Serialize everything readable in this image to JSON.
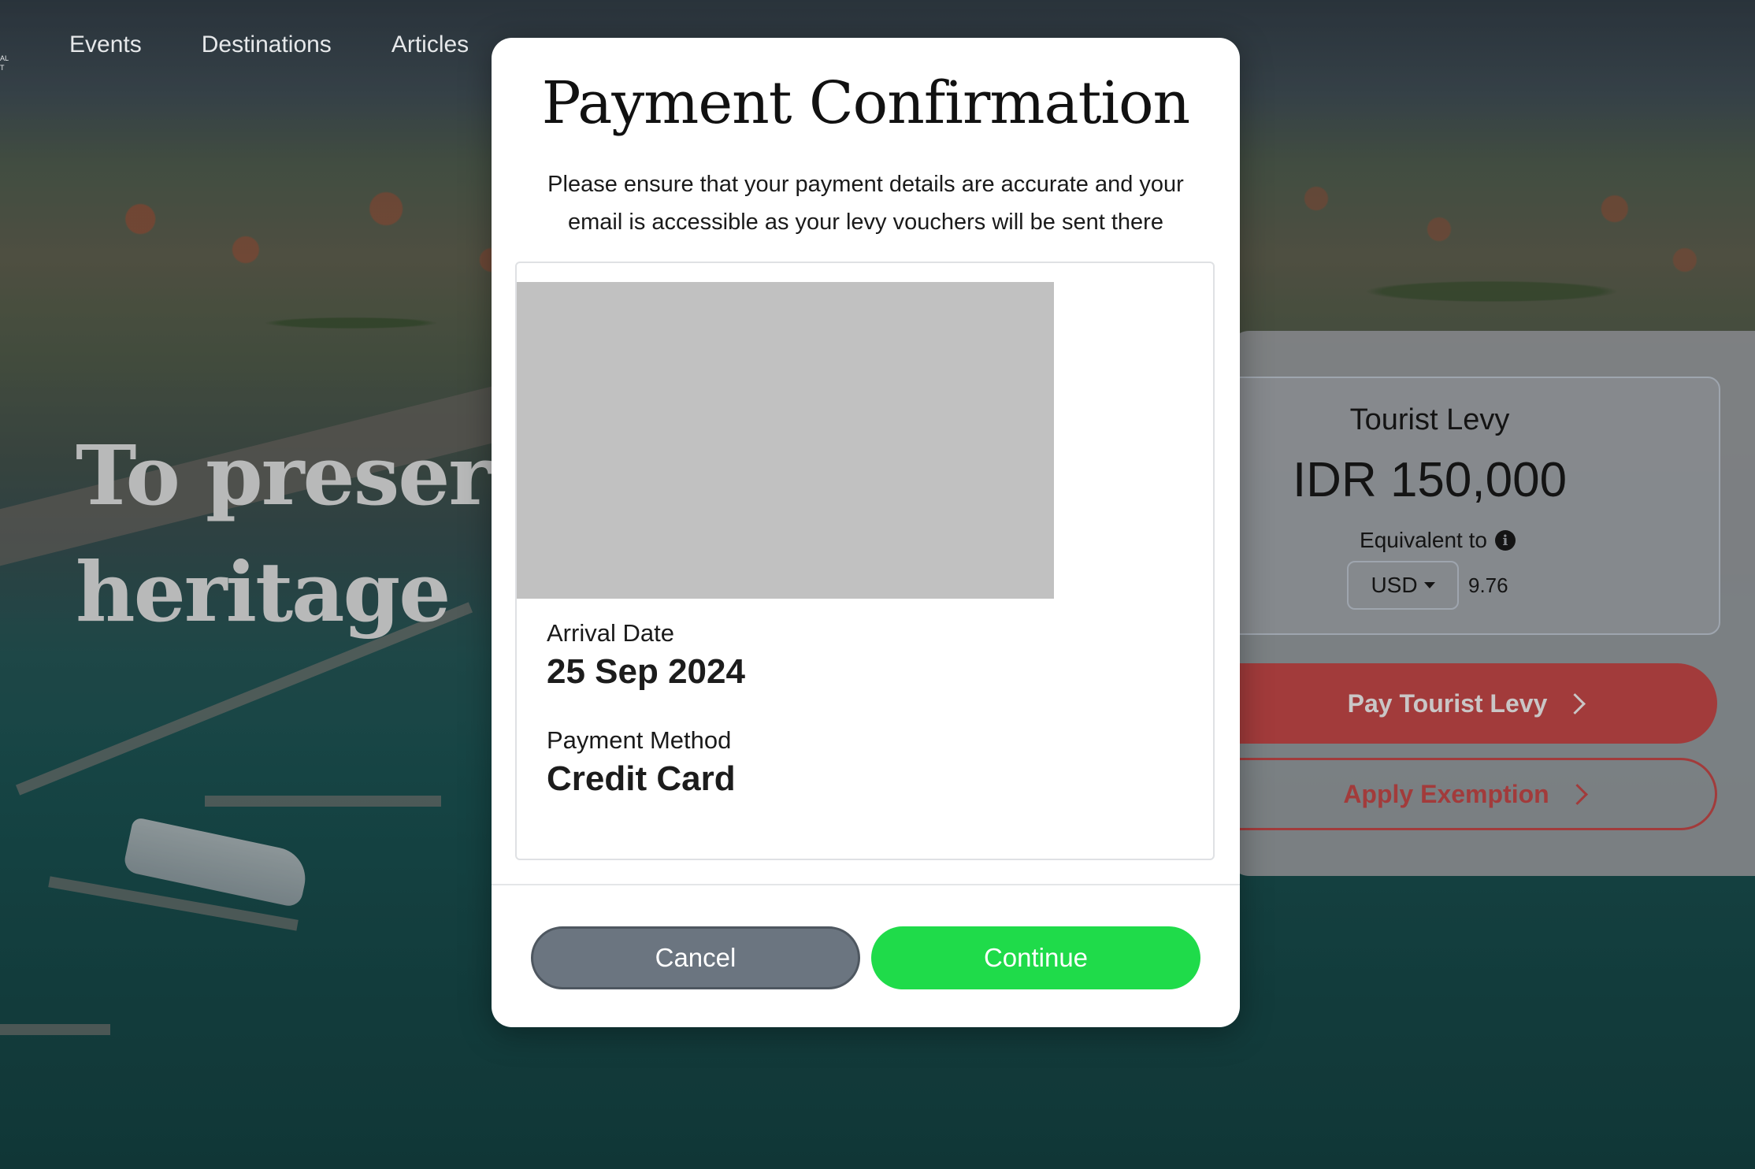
{
  "nav": {
    "items": [
      "Events",
      "Destinations",
      "Articles"
    ],
    "logo_text": "AL\nT"
  },
  "hero": {
    "line1": "To preserv",
    "line2": "heritage"
  },
  "levy": {
    "title": "Tourist Levy",
    "amount": "IDR 150,000",
    "equivalent_label": "Equivalent to",
    "currency": "USD",
    "converted_value": "9.76",
    "pay_button": "Pay Tourist Levy",
    "exemption_button": "Apply Exemption"
  },
  "modal": {
    "title": "Payment Confirmation",
    "subtitle": "Please ensure that your payment details are accurate and your email is accessible as your levy vouchers will be sent there",
    "arrival_label": "Arrival Date",
    "arrival_value": "25 Sep 2024",
    "method_label": "Payment Method",
    "method_value": "Credit Card",
    "cancel_label": "Cancel",
    "continue_label": "Continue"
  },
  "colors": {
    "continue_green": "#1fdb4a",
    "cancel_gray": "#6b7580",
    "brand_red": "#a23b3b",
    "image_placeholder": "#c1c1c1"
  },
  "icons": {
    "info": "info-icon",
    "dropdown": "chevron-down-icon",
    "arrow": "chevron-right-icon"
  }
}
